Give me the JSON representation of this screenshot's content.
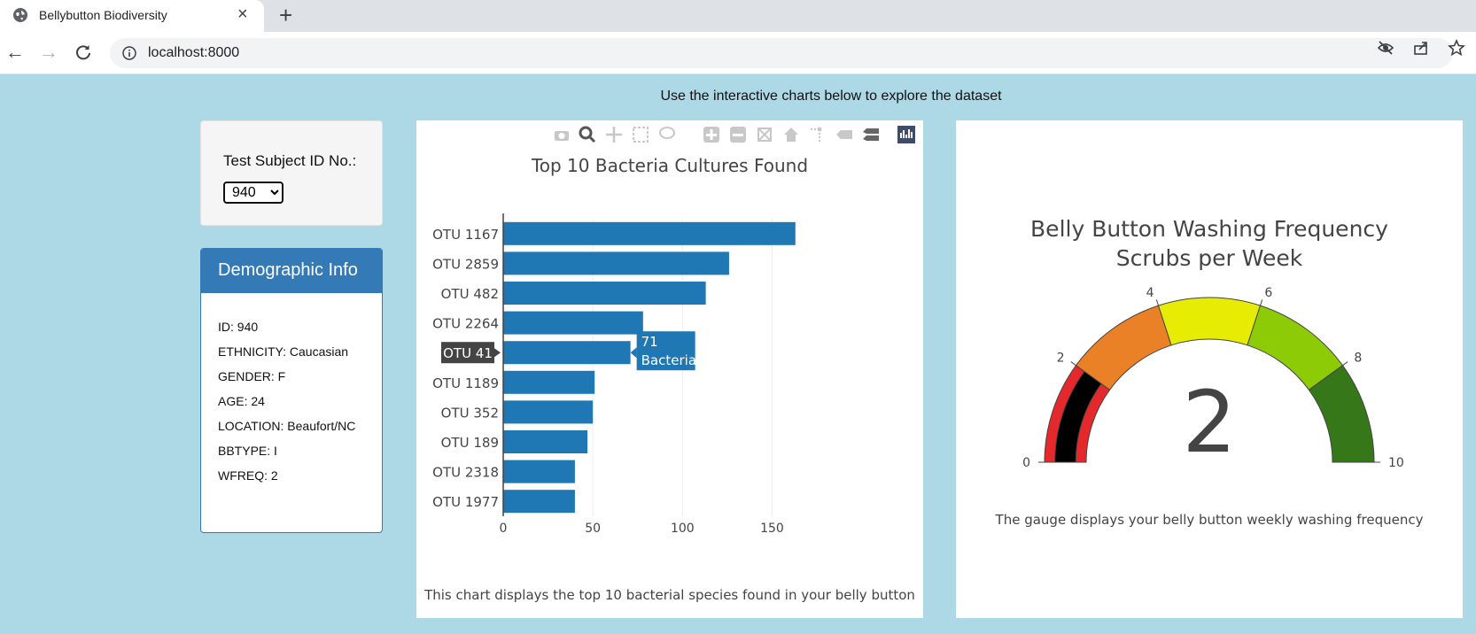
{
  "browser": {
    "tab_title": "Bellybutton Biodiversity",
    "tab_close": "×",
    "new_tab": "+",
    "url": "localhost:8000"
  },
  "page": {
    "headline": "Use the interactive charts below to explore the dataset"
  },
  "selector": {
    "label": "Test Subject ID No.:",
    "selected": "940",
    "options": [
      "940"
    ]
  },
  "demographic": {
    "title": "Demographic Info",
    "rows": [
      "ID: 940",
      "ETHNICITY: Caucasian",
      "GENDER: F",
      "AGE: 24",
      "LOCATION: Beaufort/NC",
      "BBTYPE: I",
      "WFREQ: 2"
    ]
  },
  "bar_chart": {
    "caption": "This chart displays the top 10 bacterial species found in your belly button",
    "tooltip": {
      "category": "OTU 41",
      "value": "71",
      "label": "Bacteria"
    }
  },
  "gauge_chart": {
    "title_line1": "Belly Button Washing Frequency",
    "title_line2": "Scrubs per Week",
    "caption": "The gauge displays your belly button weekly washing frequency"
  },
  "chart_data": [
    {
      "type": "bar",
      "orientation": "horizontal",
      "title": "Top 10 Bacteria Cultures Found",
      "categories": [
        "OTU 1167",
        "OTU 2859",
        "OTU 482",
        "OTU 2264",
        "OTU 41",
        "OTU 1189",
        "OTU 352",
        "OTU 189",
        "OTU 2318",
        "OTU 1977"
      ],
      "values": [
        163,
        126,
        113,
        78,
        71,
        51,
        50,
        47,
        40,
        40
      ],
      "xticks": [
        0,
        50,
        100,
        150
      ],
      "xlim": [
        0,
        172
      ],
      "grid": true,
      "color": "#1f77b4"
    },
    {
      "type": "gauge",
      "title": "Belly Button Washing Frequency",
      "subtitle": "Scrubs per Week",
      "value": 2,
      "range": [
        0,
        10
      ],
      "ticks": [
        0,
        2,
        4,
        6,
        8,
        10
      ],
      "bands": [
        {
          "range": [
            0,
            2
          ],
          "color": "#e5282c"
        },
        {
          "range": [
            2,
            4
          ],
          "color": "#ea8127"
        },
        {
          "range": [
            4,
            6
          ],
          "color": "#e6ec02"
        },
        {
          "range": [
            6,
            8
          ],
          "color": "#8dcb07"
        },
        {
          "range": [
            8,
            10
          ],
          "color": "#367719"
        }
      ],
      "bar_color": "#000000"
    }
  ]
}
